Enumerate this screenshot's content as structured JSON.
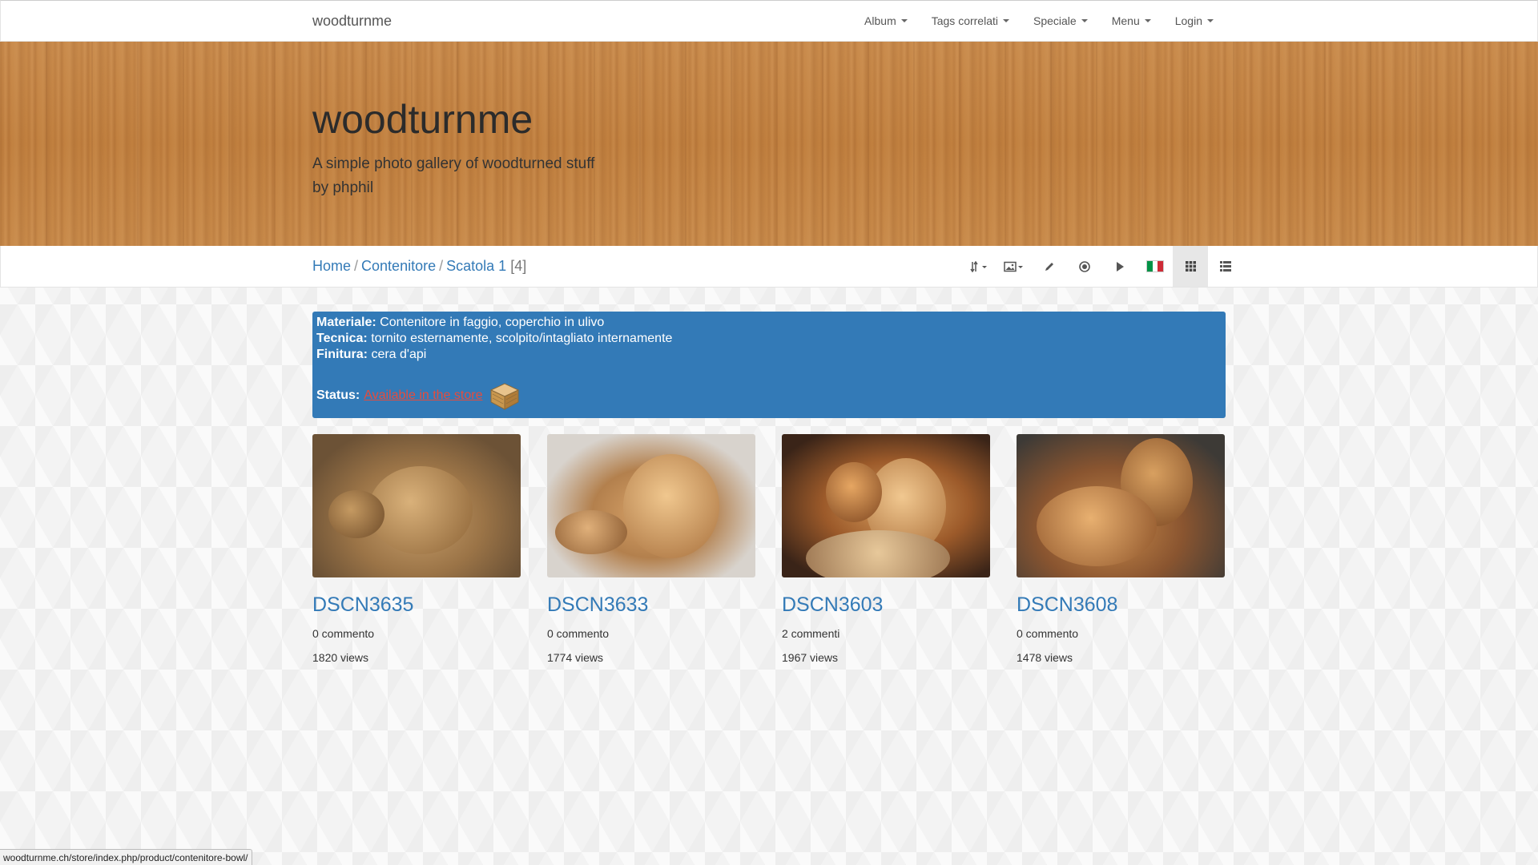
{
  "navbar": {
    "brand": "woodturnme",
    "items": [
      {
        "label": "Album"
      },
      {
        "label": "Tags correlati"
      },
      {
        "label": "Speciale"
      },
      {
        "label": "Menu"
      },
      {
        "label": "Login"
      }
    ]
  },
  "header": {
    "title": "woodturnme",
    "subtitle_line1": "A simple photo gallery of woodturned stuff",
    "subtitle_line2": "by phphil"
  },
  "breadcrumb": {
    "home": "Home",
    "sep": "/",
    "level1": "Contenitore",
    "level2": "Scatola 1",
    "count": "[4]"
  },
  "toolbar": {
    "icons": [
      "sort-icon",
      "image-icon",
      "edit-icon",
      "record-icon",
      "play-icon",
      "italy-flag-icon",
      "grid-view-icon",
      "list-view-icon"
    ],
    "flag_colors": [
      "#009246",
      "#ffffff",
      "#ce2b37"
    ]
  },
  "info": {
    "materiale_label": "Materiale:",
    "materiale_value": "Contenitore in faggio, coperchio in ulivo",
    "tecnica_label": "Tecnica:",
    "tecnica_value": "tornito esternamente, scolpito/intagliato internamente",
    "finitura_label": "Finitura:",
    "finitura_value": "cera d'api",
    "status_label": "Status:",
    "status_link": "Available in the store"
  },
  "photos": [
    {
      "title": "DSCN3635",
      "comments": "0 commento",
      "views": "1820 views"
    },
    {
      "title": "DSCN3633",
      "comments": "0 commento",
      "views": "1774 views"
    },
    {
      "title": "DSCN3603",
      "comments": "2 commenti",
      "views": "1967 views"
    },
    {
      "title": "DSCN3608",
      "comments": "0 commento",
      "views": "1478 views"
    }
  ],
  "statusbar": {
    "url": "woodturnme.ch/store/index.php/product/contenitore-bowl/"
  },
  "colors": {
    "link": "#337ab7",
    "info_bg": "#337ab7",
    "store_link": "#e74c3c"
  }
}
